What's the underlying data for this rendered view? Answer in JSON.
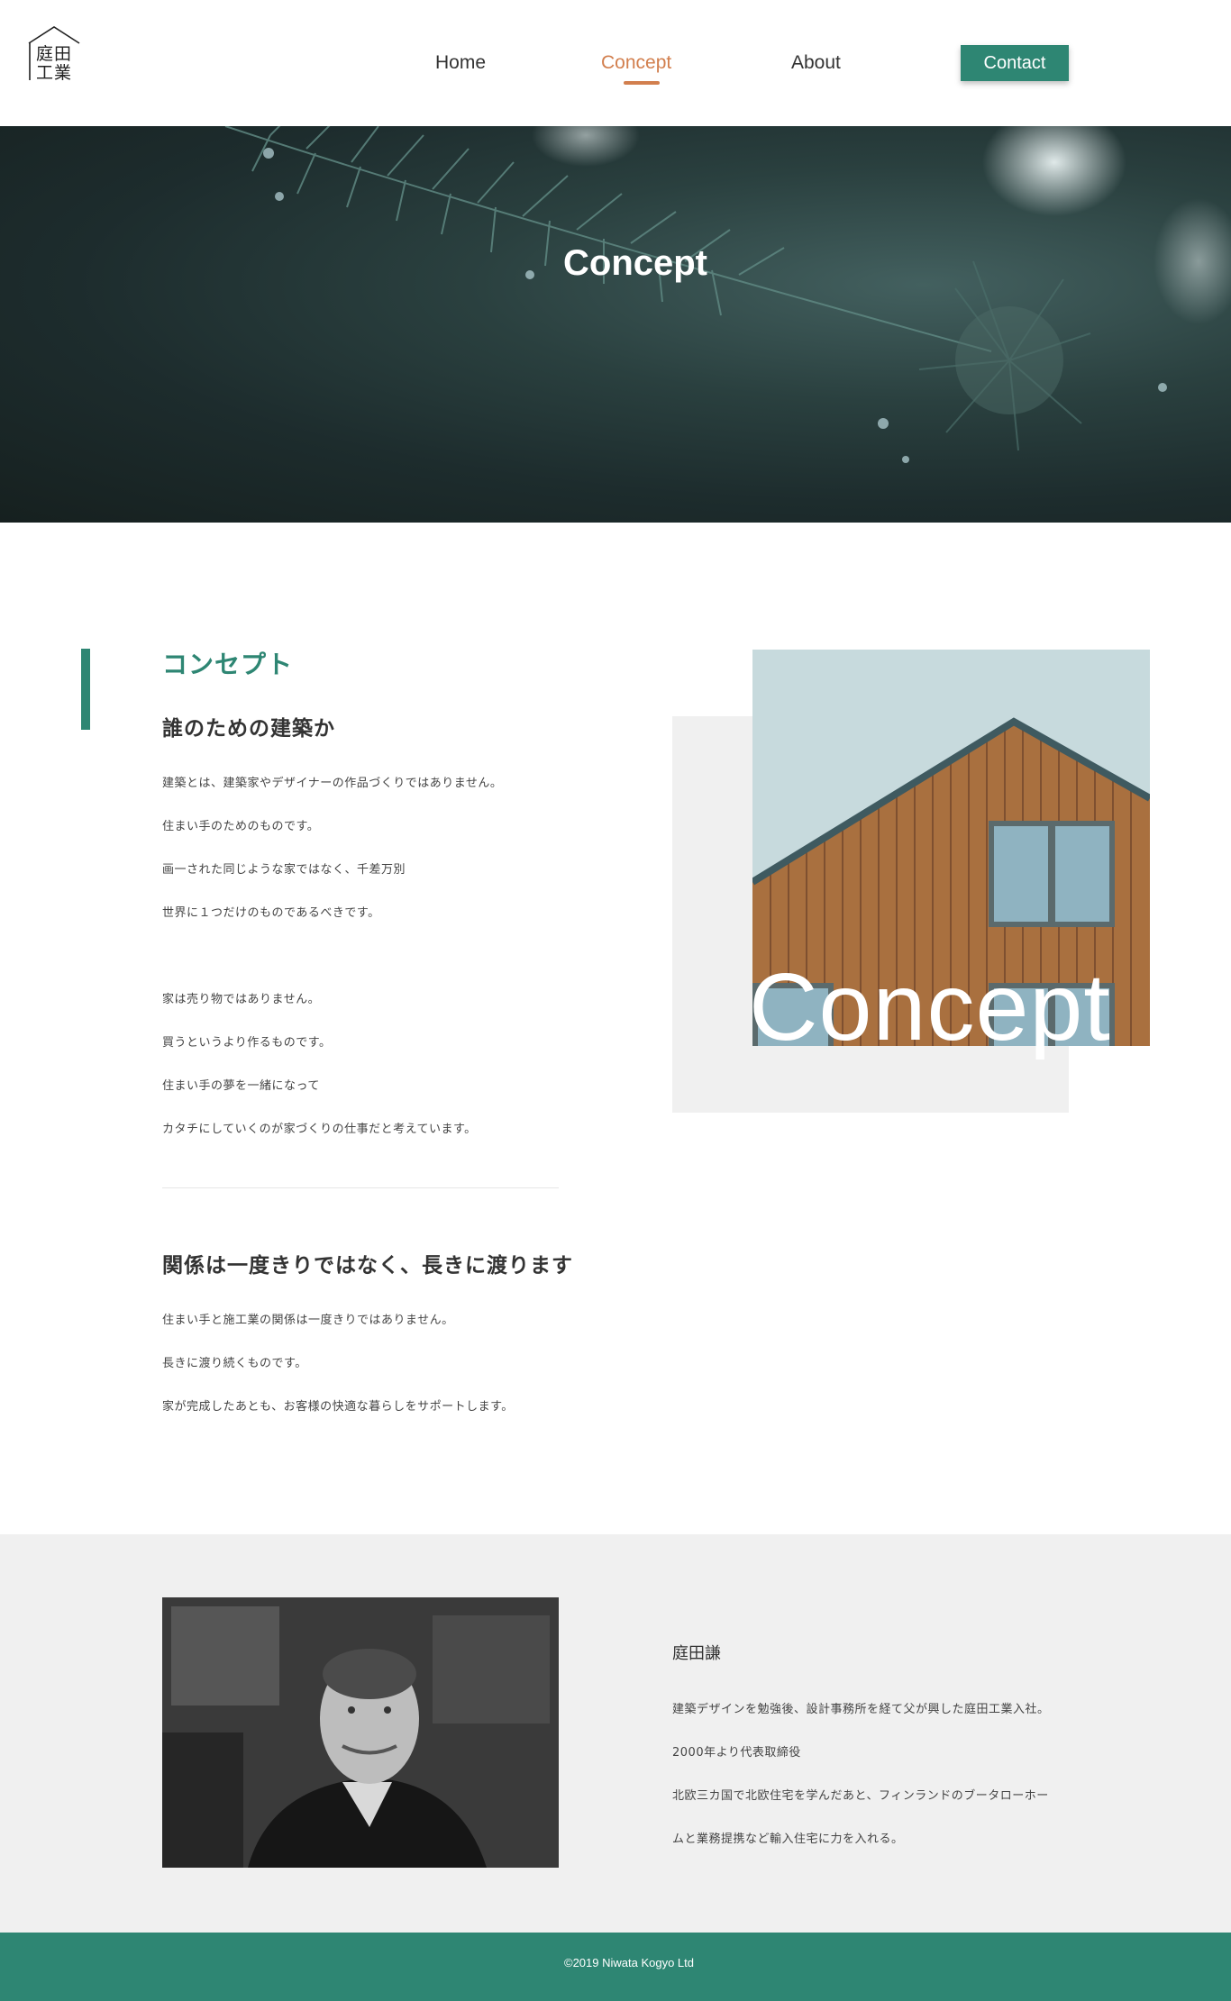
{
  "header": {
    "logo_text": "庭田\n工業",
    "nav": {
      "home": "Home",
      "concept": "Concept",
      "about": "About",
      "contact": "Contact"
    }
  },
  "hero": {
    "title": "Concept"
  },
  "concept": {
    "heading": "コンセプト",
    "subheading1": "誰のための建築か",
    "block1": [
      "建築とは、建築家やデザイナーの作品づくりではありません。",
      "住まい手のためのものです。",
      "画一された同じような家ではなく、千差万別",
      "世界に１つだけのものであるべきです。"
    ],
    "block2": [
      "家は売り物ではありません。",
      "買うというより作るものです。",
      "住まい手の夢を一緒になって",
      "カタチにしていくのが家づくりの仕事だと考えています。"
    ],
    "subheading2": "関係は一度きりではなく、長きに渡ります",
    "block3": [
      "住まい手と施工業の関係は一度きりではありません。",
      "長きに渡り続くものです。",
      "家が完成したあとも、お客様の快適な暮らしをサポートします。"
    ],
    "image_overlay": "Concept"
  },
  "profile": {
    "name": "庭田謙",
    "lines": [
      "建築デザインを勉強後、設計事務所を経て父が興した庭田工業入社。",
      "2000年より代表取締役",
      "北欧三カ国で北欧住宅を学んだあと、フィンランドのブータローホー",
      "ムと業務提携など輸入住宅に力を入れる。"
    ]
  },
  "footer": {
    "copyright": "©2019 Niwata Kogyo Ltd"
  },
  "colors": {
    "accent": "#2e8673",
    "active_nav": "#d27f4e",
    "section_bg": "#f0f0f0"
  },
  "icons": {
    "logo": "house-outline-icon"
  }
}
